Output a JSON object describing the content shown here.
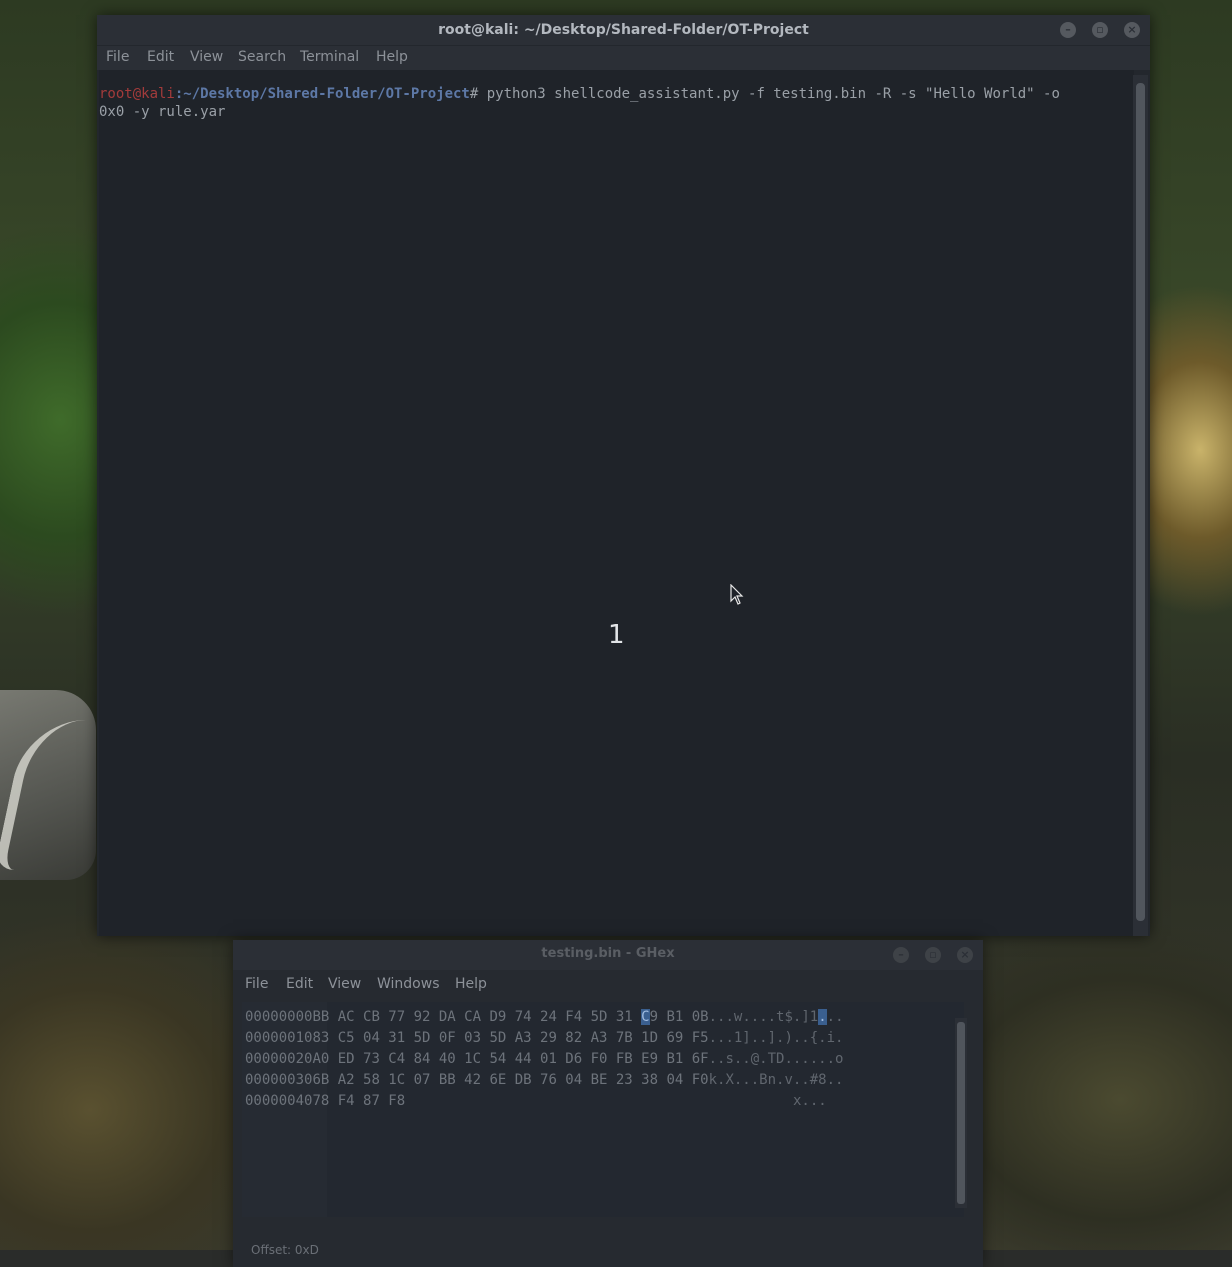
{
  "terminal": {
    "title": "root@kali: ~/Desktop/Shared-Folder/OT-Project",
    "menu": [
      "File",
      "Edit",
      "View",
      "Search",
      "Terminal",
      "Help"
    ],
    "prompt_user": "root@kali",
    "prompt_path": ":~/Desktop/Shared-Folder/OT-Project",
    "command_line1": "# python3 shellcode_assistant.py -f testing.bin -R -s \"Hello World\" -o",
    "command_line2": "0x0 -y rule.yar",
    "overlay_number": "1"
  },
  "ghex": {
    "title": "testing.bin - GHex",
    "menu": [
      "File",
      "Edit",
      "View",
      "Windows",
      "Help"
    ],
    "rows": [
      {
        "offset": "00000000",
        "bytes_pre": "BB AC CB 77 92 DA CA D9 74 24 F4 5D 31 ",
        "bytes_sel": "C",
        "bytes_post": "9 B1 0B",
        "ascii_pre": "...w....t$.]1",
        "ascii_sel": ".",
        "ascii_post": ".."
      },
      {
        "offset": "00000010",
        "bytes_pre": "83 C5 04 31 5D 0F 03 5D A3 29 82 A3 7B 1D 69 F5",
        "bytes_sel": "",
        "bytes_post": "",
        "ascii_pre": "...1]..].)..{.i.",
        "ascii_sel": "",
        "ascii_post": ""
      },
      {
        "offset": "00000020",
        "bytes_pre": "A0 ED 73 C4 84 40 1C 54 44 01 D6 F0 FB E9 B1 6F",
        "bytes_sel": "",
        "bytes_post": "",
        "ascii_pre": "..s..@.TD......o",
        "ascii_sel": "",
        "ascii_post": ""
      },
      {
        "offset": "00000030",
        "bytes_pre": "6B A2 58 1C 07 BB 42 6E DB 76 04 BE 23 38 04 F0",
        "bytes_sel": "",
        "bytes_post": "",
        "ascii_pre": "k.X...Bn.v..#8..",
        "ascii_sel": "",
        "ascii_post": ""
      },
      {
        "offset": "00000040",
        "bytes_pre": "78 F4 87 F8",
        "bytes_sel": "",
        "bytes_post": "",
        "ascii_pre": "x...",
        "ascii_sel": "",
        "ascii_post": ""
      }
    ],
    "status": "Offset: 0xD"
  }
}
